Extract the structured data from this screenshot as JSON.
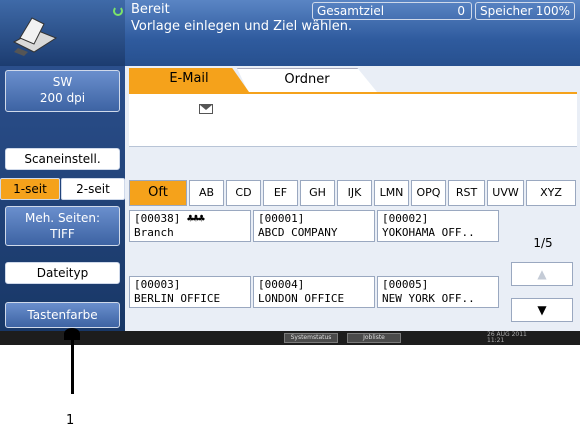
{
  "status": {
    "state": "Bereit",
    "message": "Vorlage einlegen und Ziel wählen.",
    "total_label": "Gesamtziel",
    "total_value": "0",
    "memory_label": "Speicher",
    "memory_value": "100%"
  },
  "left_panel": {
    "resolution_line1": "SW",
    "resolution_line2": "200 dpi",
    "scan_settings": "Scaneinstell.",
    "duplex_one": "1-seit",
    "duplex_two": "2-seit",
    "multi_line1": "Meh. Seiten:",
    "multi_line2": "TIFF",
    "file_type": "Dateityp",
    "key_color": "Tastenfarbe"
  },
  "tabs": [
    "E-Mail",
    "Ordner"
  ],
  "alpha_tabs": [
    "Oft",
    "AB",
    "CD",
    "EF",
    "GH",
    "IJK",
    "LMN",
    "OPQ",
    "RST",
    "UVW",
    "XYZ"
  ],
  "destinations": [
    {
      "id": "[00038]",
      "name": "Branch",
      "group": "♣♣♣"
    },
    {
      "id": "[00001]",
      "name": "ABCD COMPANY",
      "group": ""
    },
    {
      "id": "[00002]",
      "name": "YOKOHAMA OFF..",
      "group": ""
    },
    {
      "id": "[00003]",
      "name": "BERLIN OFFICE",
      "group": ""
    },
    {
      "id": "[00004]",
      "name": "LONDON OFFICE",
      "group": ""
    },
    {
      "id": "[00005]",
      "name": "NEW YORK OFF..",
      "group": ""
    }
  ],
  "pager": {
    "page": "1/5",
    "up": "▲",
    "down": "▼"
  },
  "bottom_bar": {
    "status_button": "Systemstatus",
    "jobs_button": "Jobliste",
    "clock_date": "26 AUG 2011",
    "clock_time": "11:21"
  },
  "callout": {
    "number": "1"
  },
  "colors": {
    "accent": "#f5a21b",
    "panel": "#2b4f8c",
    "status": "#2f5b9e"
  },
  "icons": [
    "scanner-logo-icon",
    "ready-indicator-icon",
    "mail-envelope-icon",
    "arrow-up-icon",
    "arrow-down-icon"
  ]
}
